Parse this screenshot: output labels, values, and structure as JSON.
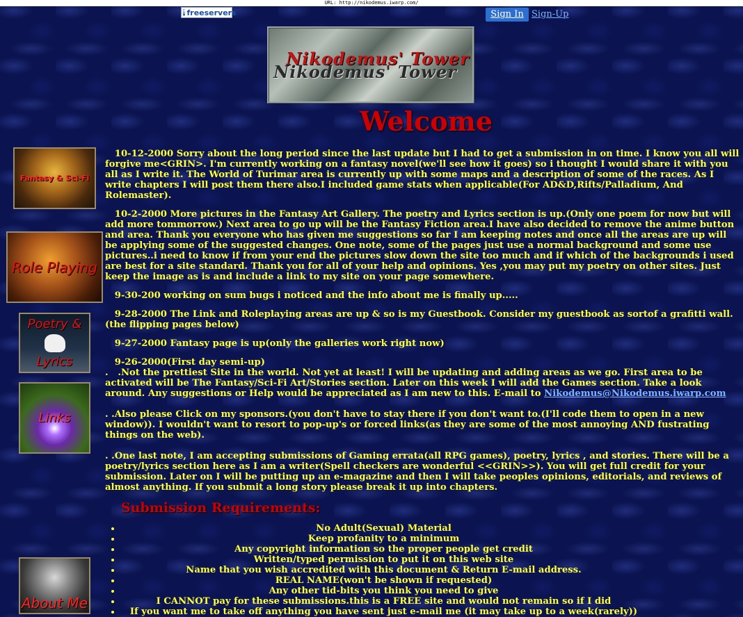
{
  "url_bar": "URL: http://nikodemus.iwarp.com/",
  "header": {
    "sponsor_logo_text": "freeservers",
    "sign_in": "Sign In",
    "sign_up": "Sign-Up"
  },
  "banner": {
    "title_red": "Nikodemus' Tower",
    "title_dark": "Nikodemus' Tower"
  },
  "welcome": "Welcome",
  "nav": {
    "fantasy": "Fantasy & Sci-Fi",
    "role_playing": "Role Playing",
    "poetry_line1": "Poetry &",
    "poetry_line2": "Lyrics",
    "links": "Links",
    "about": "About Me"
  },
  "updates": [
    "   10-12-2000 Sorry about the long period since the last update but I had to get a submission in on time. I know you all will forgive me<GRIN>. I'm currently working on a fantasy novel(we'll see how it goes) so i thought I would share it with you all as I write it. The World of Turimar area is currently up with some maps and a description of some of the races. As I write chapters I will post them there also.I included game stats when applicable(For AD&D,Rifts/Palladium, And Rolemaster).",
    "   10-2-2000 More pictures in the Fantasy Art Gallery. The poetry and Lyrics section is up.(Only  one poem for now but will add more tommorrow.) Next area to go up will be the Fantasy Fiction area.I have also decided to remove the anime button and area. Thank you everyone who has given me suggestions so far I am keeping notes and once all the areas are up will be applying some of the suggested changes. One note, some of the pages just use a normal background and some use pictures..i need to know if from your end the pictures slow down the site too much and if which of the backgrounds i used are best for a site standard. Thank you for all of your help and opinions. Yes ,you may put my poetry on other sites. Just keep the image as is and include a link to my site on your page somewhere.",
    "   9-30-200 working on sum bugs i noticed and the info about me is finally up.....",
    "   9-28-2000 The Link and Roleplaying areas are up & so is my Guestbook. Consider my guestbook as sortof a grafitti wall.(the flipping pages below)",
    "   9-27-2000 Fantasy page is up(only the galleries work right now)"
  ],
  "first_day": {
    "heading": "   9-26-2000(First day semi-up)",
    "text": ".   .Not the prettiest Site in the world. Not yet at least! I will be updating and adding areas as we go. First area to be activated will be The Fantasy/Sci-Fi Art/Stories section. Later on this week I will add the Games section. Take a look around. Any suggestions or Help would be appreciated as I am new to this. E-mail to ",
    "email": "Nikodemus@Nikodemus.iwarp.com"
  },
  "notes": [
    ". .Also please Click on my sponsors.(you don't have to stay there if you don't want to.(I'll code them to open in a new window)). I wouldn't want to resort to pop-up's or forced links(as they are some of the most annoying AND fustrating things on the web).",
    ". .One last note, I am accepting submissions of Gaming errata(all RPG games), poetry, lyrics , and stories. There will be a poetry/lyrics section here as I am a writer(Spell checkers are wonderful <<GRIN>>). You will get full credit for your submission. Later on I will be putting up an e-magazine and then I will take peoples opinions, editorials, and reviews of almost anything. If you submit a long story please break it up into chapters."
  ],
  "requirements": {
    "title": "Submission Requirements:",
    "items": [
      "No Adult(Sexual) Material",
      "Keep profanity to a minimum",
      "Any copyright information so the proper people get credit",
      "Written/typed permission to put it on this web site",
      "Name that you wish accredited with this document & Return E-mail address.",
      "REAL NAME(won't be shown if requested)",
      "Any other tid-bits you think you need to give",
      "I CANNOT pay for these submissions.this is a FREE site and would not remain so if I did",
      "If you want me to take off anything you have sent just e-mail me (it may take up to a week(rarely))"
    ]
  }
}
